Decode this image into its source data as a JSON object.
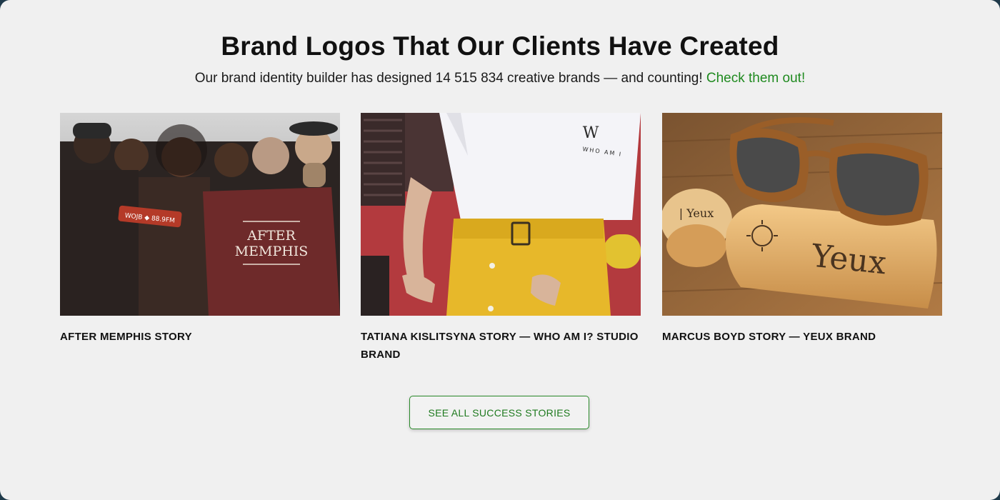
{
  "section": {
    "title": "Brand Logos That Our Clients Have Created",
    "subtitle_text": "Our brand identity builder has designed 14 515 834 creative brands — and counting!",
    "subtitle_link": "Check them out!",
    "link_color": "#1f8a1f"
  },
  "stories": [
    {
      "caption": "After Memphis Story",
      "image_alt": "Group of smiling men and women holding an After Memphis t-shirt",
      "shirt_text_line1": "AFTER",
      "shirt_text_line2": "MEMPHIS",
      "sign_text": "WOJB ◆ 88.9FM"
    },
    {
      "caption": "Tatiana Kislitsyna Story — Who Am I? Studio Brand",
      "image_alt": "Woman in white t-shirt with Who Am I logo and yellow skirt",
      "shirt_logo": "W",
      "shirt_text": "WHO AM I"
    },
    {
      "caption": "Marcus Boyd Story — Yeux Brand",
      "image_alt": "Wooden sunglasses on a bamboo case engraved with Yeux",
      "engraving": "Yeux",
      "small_engraving": "| Yeux"
    }
  ],
  "cta": {
    "label": "SEE ALL SUCCESS STORIES",
    "color": "#1f7a1f"
  }
}
